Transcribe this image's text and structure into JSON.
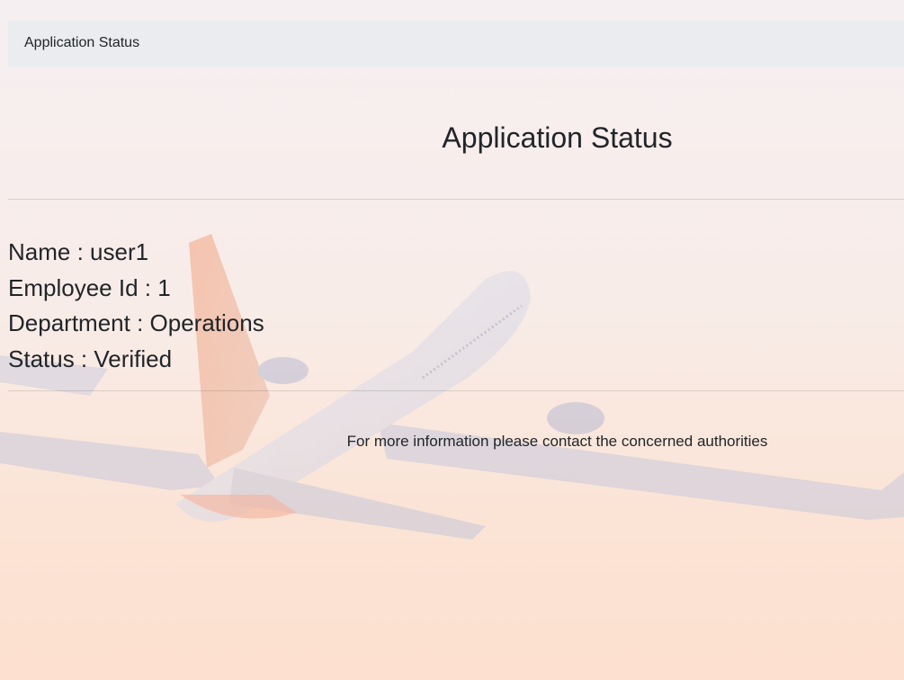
{
  "navbar": {
    "brand": "Application Status"
  },
  "page": {
    "title": "Application Status",
    "details": {
      "name": "Name : user1",
      "employee_id": "Employee Id : 1",
      "department": "Department : Operations",
      "status": "Status : Verified"
    },
    "footer_note": "For more information please contact the concerned authorities"
  },
  "background": {
    "image_subject": "airplane-taking-off",
    "colors": {
      "sky_top": "#f6eff1",
      "sky_bottom": "#fde0cf",
      "plane_body": "#dcdde8",
      "tail_accent": "#f2a07c"
    }
  }
}
